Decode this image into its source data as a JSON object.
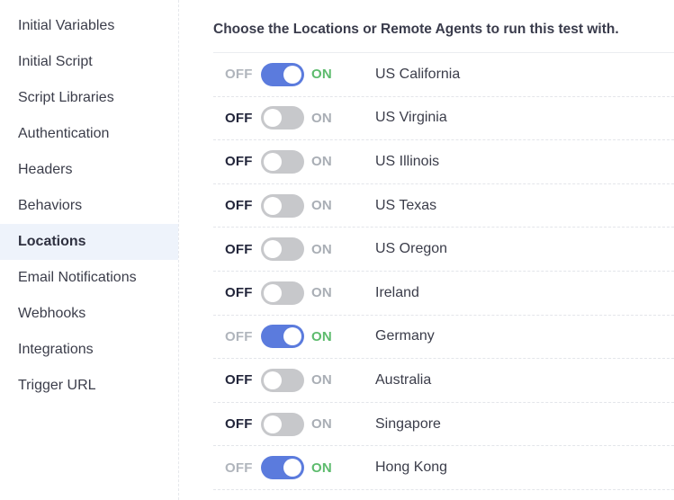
{
  "sidebar": {
    "items": [
      {
        "label": "Initial Variables",
        "active": false
      },
      {
        "label": "Initial Script",
        "active": false
      },
      {
        "label": "Script Libraries",
        "active": false
      },
      {
        "label": "Authentication",
        "active": false
      },
      {
        "label": "Headers",
        "active": false
      },
      {
        "label": "Behaviors",
        "active": false
      },
      {
        "label": "Locations",
        "active": true
      },
      {
        "label": "Email Notifications",
        "active": false
      },
      {
        "label": "Webhooks",
        "active": false
      },
      {
        "label": "Integrations",
        "active": false
      },
      {
        "label": "Trigger URL",
        "active": false
      }
    ]
  },
  "main": {
    "intro": "Choose the Locations or Remote Agents to run this test with.",
    "off_label": "OFF",
    "on_label": "ON",
    "locations": [
      {
        "name": "US California",
        "enabled": true
      },
      {
        "name": "US Virginia",
        "enabled": false
      },
      {
        "name": "US Illinois",
        "enabled": false
      },
      {
        "name": "US Texas",
        "enabled": false
      },
      {
        "name": "US Oregon",
        "enabled": false
      },
      {
        "name": "Ireland",
        "enabled": false
      },
      {
        "name": "Germany",
        "enabled": true
      },
      {
        "name": "Australia",
        "enabled": false
      },
      {
        "name": "Singapore",
        "enabled": false
      },
      {
        "name": "Hong Kong",
        "enabled": true
      }
    ]
  },
  "colors": {
    "toggle_on": "#5b7bdd",
    "toggle_off": "#c7c8cb",
    "on_label_active": "#5dbb6d",
    "off_label_active": "#22253a",
    "inactive_label": "#a9aeb5",
    "sidebar_active_bg": "#eef3fb"
  }
}
